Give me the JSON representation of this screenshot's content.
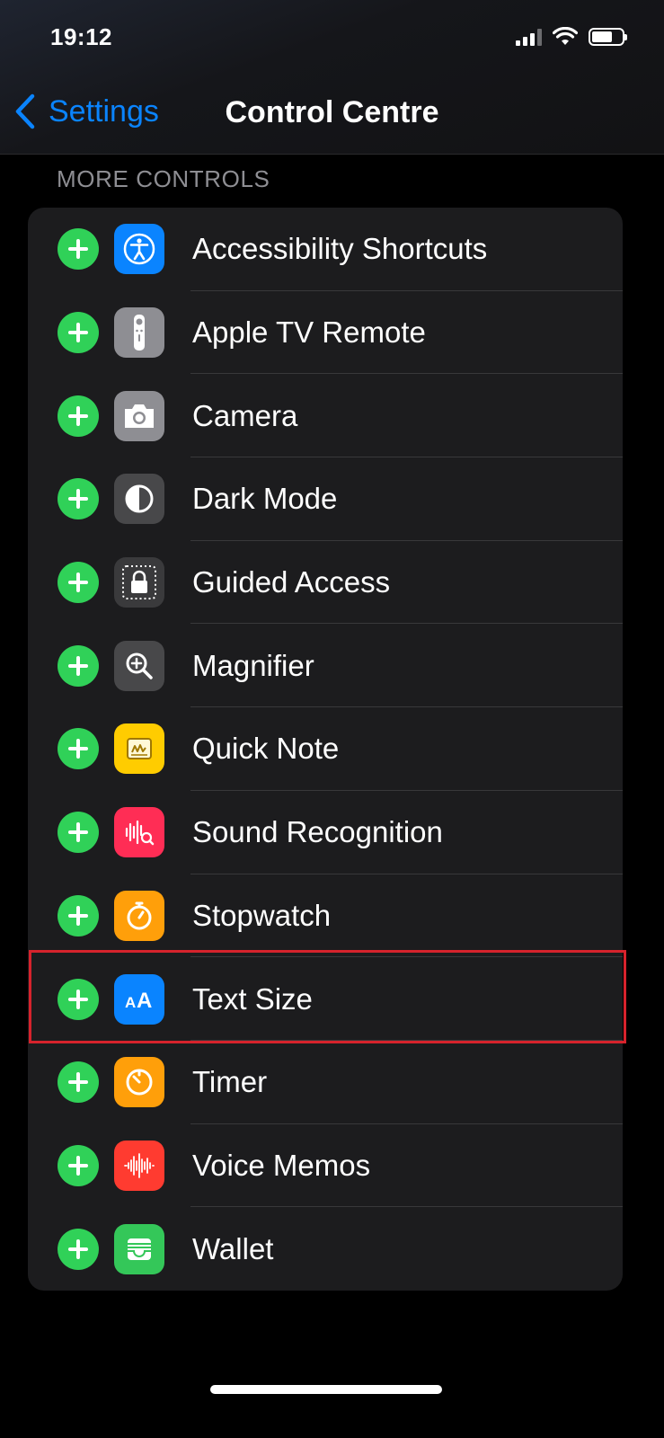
{
  "status_bar": {
    "time": "19:12"
  },
  "nav": {
    "back_label": "Settings",
    "title": "Control Centre"
  },
  "section_header": "MORE CONTROLS",
  "controls": [
    {
      "label": "Accessibility Shortcuts",
      "icon": "accessibility-icon",
      "color": "#0a84ff"
    },
    {
      "label": "Apple TV Remote",
      "icon": "remote-icon",
      "color": "#8e8e93"
    },
    {
      "label": "Camera",
      "icon": "camera-icon",
      "color": "#8e8e93"
    },
    {
      "label": "Dark Mode",
      "icon": "dark-mode-icon",
      "color": "#48484a"
    },
    {
      "label": "Guided Access",
      "icon": "lock-icon",
      "color": "#3a3a3c"
    },
    {
      "label": "Magnifier",
      "icon": "magnifier-icon",
      "color": "#48484a"
    },
    {
      "label": "Quick Note",
      "icon": "quick-note-icon",
      "color": "#ffcc00"
    },
    {
      "label": "Sound Recognition",
      "icon": "sound-recognition-icon",
      "color": "#ff2d55"
    },
    {
      "label": "Stopwatch",
      "icon": "stopwatch-icon",
      "color": "#ff9f0a"
    },
    {
      "label": "Text Size",
      "icon": "text-size-icon",
      "color": "#0a84ff"
    },
    {
      "label": "Timer",
      "icon": "timer-icon",
      "color": "#ff9f0a"
    },
    {
      "label": "Voice Memos",
      "icon": "voice-memos-icon",
      "color": "#ff3b30"
    },
    {
      "label": "Wallet",
      "icon": "wallet-icon",
      "color": "#34c759"
    }
  ],
  "highlighted_control": "Text Size",
  "colors": {
    "accent": "#0a84ff",
    "add": "#30d158",
    "highlight": "#d6232c"
  }
}
